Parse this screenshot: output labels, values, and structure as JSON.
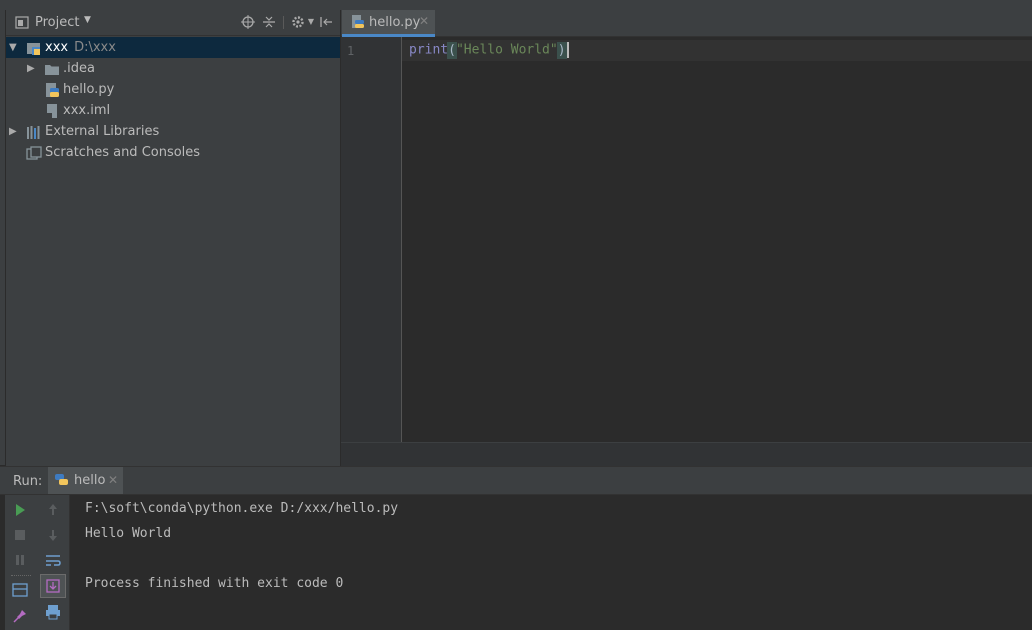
{
  "project_panel": {
    "title": "Project",
    "tree": [
      {
        "label": "xxx",
        "path": "D:\\xxx",
        "expanded": true,
        "selected": true
      },
      {
        "label": ".idea"
      },
      {
        "label": "hello.py"
      },
      {
        "label": "xxx.iml"
      },
      {
        "label": "External Libraries"
      },
      {
        "label": "Scratches and Consoles"
      }
    ]
  },
  "editor": {
    "tab_label": "hello.py",
    "line_number": "1",
    "code": {
      "keyword": "print",
      "open_paren": "(",
      "string": "\"Hello World\"",
      "close_paren": ")"
    }
  },
  "run_panel": {
    "label": "Run:",
    "tab_label": "hello",
    "console_lines": [
      "F:\\soft\\conda\\python.exe D:/xxx/hello.py",
      "Hello World",
      "",
      "Process finished with exit code 0"
    ]
  },
  "colors": {
    "accent": "#4a88c7",
    "run_green": "#499c54",
    "selection": "#0d293e"
  }
}
